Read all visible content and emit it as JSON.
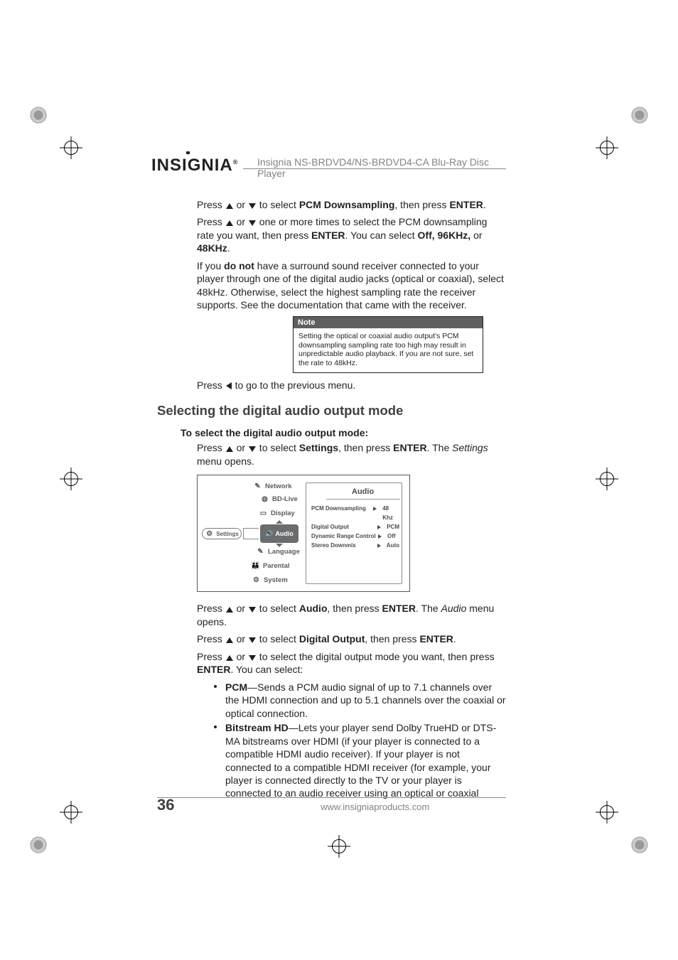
{
  "brand": "INSIGNIA",
  "header_product": "Insignia NS-BRDVD4/NS-BRDVD4-CA Blu-Ray Disc Player",
  "p1_a": "Press ",
  "p1_b": " or ",
  "p1_c": " to select ",
  "p1_bold": "PCM Downsampling",
  "p1_d": ", then press ",
  "p1_enter": "ENTER",
  "p1_e": ".",
  "p2_a": "Press ",
  "p2_b": " or ",
  "p2_c": " one or more times to select the PCM downsampling rate you want, then press ",
  "p2_enter": "ENTER",
  "p2_d": ". You can select ",
  "p2_off": "Off, 96KHz,",
  "p2_e": " or ",
  "p2_48": "48KHz",
  "p2_f": ".",
  "p3_a": "If you ",
  "p3_bold": "do not",
  "p3_b": " have a surround sound receiver connected to your player through one of the digital audio jacks (optical or coaxial), select 48kHz. Otherwise, select the highest sampling rate the receiver supports. See the documentation that came with the receiver.",
  "note_title": "Note",
  "note_body": "Setting the optical or coaxial audio output's PCM downsampling sampling rate too high may result in unpredictable audio playback. If you are not sure, set the rate to 48kHz.",
  "p4_a": "Press ",
  "p4_b": " to go to the previous menu.",
  "h2": "Selecting the digital audio output mode",
  "h3": "To select the digital audio output mode:",
  "p5_a": "Press ",
  "p5_b": " or ",
  "p5_c": " to select ",
  "p5_settings": "Settings",
  "p5_d": ", then press ",
  "p5_enter": "ENTER",
  "p5_e": ". The ",
  "p5_it": "Settings",
  "p5_f": " menu opens.",
  "osd": {
    "settings_label": "Settings",
    "menu": {
      "network": "Network",
      "bdlive": "BD-Live",
      "display": "Display",
      "audio": "Audio",
      "language": "Language",
      "parental": "Parental",
      "system": "System"
    },
    "panel_title": "Audio",
    "rows": [
      {
        "k": "PCM Downsampling",
        "v": "48 Khz"
      },
      {
        "k": "Digital Output",
        "v": "PCM"
      },
      {
        "k": "Dynamic Range Control",
        "v": "Off"
      },
      {
        "k": "Stereo Downmix",
        "v": "Auto"
      }
    ]
  },
  "p6_a": "Press ",
  "p6_b": " or ",
  "p6_c": " to select ",
  "p6_audio": "Audio",
  "p6_d": ", then press ",
  "p6_enter": "ENTER",
  "p6_e": ". The ",
  "p6_it": "Audio",
  "p6_f": " menu opens.",
  "p7_a": "Press ",
  "p7_b": " or ",
  "p7_c": " to select ",
  "p7_do": "Digital Output",
  "p7_d": ", then press ",
  "p7_enter": "ENTER",
  "p7_e": ".",
  "p8_a": "Press ",
  "p8_b": " or ",
  "p8_c": " to select the digital output mode you want, then press ",
  "p8_enter": "ENTER",
  "p8_d": ". You can select:",
  "bullets": [
    {
      "lead": "PCM",
      "rest": "—Sends a PCM audio signal of up to 7.1 channels over the HDMI connection and up to 5.1 channels over the coaxial or optical connection."
    },
    {
      "lead": "Bitstream HD",
      "rest": "—Lets your player send Dolby TrueHD or DTS-MA bitstreams over HDMI (if your player is connected to a compatible HDMI audio receiver). If your player is not connected to a compatible HDMI receiver (for example, your player is connected directly to the TV or your player is connected to an audio receiver using an optical or coaxial"
    }
  ],
  "page_number": "36",
  "footer_url": "www.insigniaproducts.com"
}
